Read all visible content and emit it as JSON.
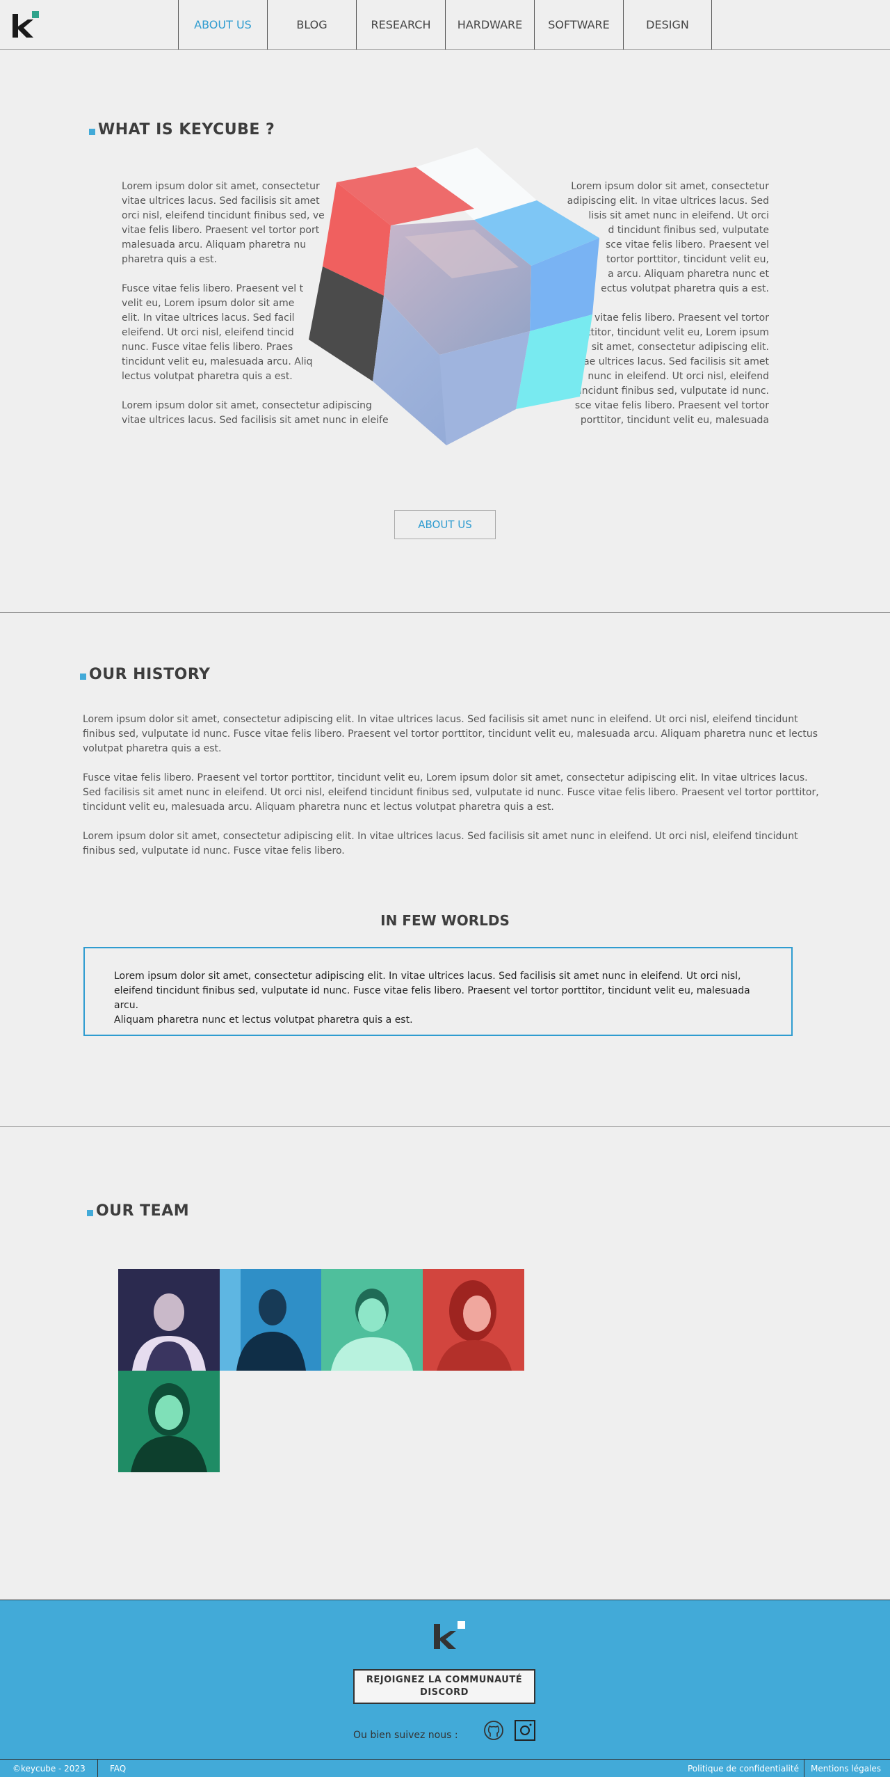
{
  "nav": {
    "items": [
      {
        "label": "ABOUT US",
        "active": true
      },
      {
        "label": "BLOG"
      },
      {
        "label": "RESEARCH"
      },
      {
        "label": "HARDWARE"
      },
      {
        "label": "SOFTWARE"
      },
      {
        "label": "DESIGN"
      }
    ]
  },
  "colors": {
    "accent": "#2f9cd0",
    "footer_bg": "#42aad8",
    "logo_green": "#2fa38b"
  },
  "what": {
    "title": "WHAT IS KEYCUBE ?",
    "left_lines_1": [
      "Lorem ipsum dolor sit amet, consectetur",
      "vitae ultrices lacus. Sed facilisis sit amet",
      "orci nisl, eleifend tincidunt finibus sed, ve",
      "vitae felis libero. Praesent vel tortor port",
      "malesuada arcu. Aliquam pharetra nu",
      "pharetra quis a est."
    ],
    "left_lines_2": [
      "Fusce vitae felis libero. Praesent vel t",
      "velit eu,  Lorem ipsum dolor sit ame",
      "elit. In vitae ultrices lacus. Sed facil",
      "eleifend. Ut orci nisl, eleifend tincid",
      "nunc. Fusce vitae felis libero. Praes",
      "tincidunt velit eu, malesuada arcu. Aliq",
      "lectus volutpat pharetra quis a est."
    ],
    "left_lines_3": [
      "Lorem ipsum dolor sit amet, consectetur adipiscing",
      "vitae ultrices lacus. Sed facilisis sit amet nunc in eleife"
    ],
    "right_lines_1": [
      "Lorem ipsum dolor sit amet, consectetur",
      "adipiscing elit. In vitae ultrices lacus. Sed",
      "lisis sit amet nunc in eleifend. Ut orci",
      "d tincidunt finibus sed, vulputate",
      "sce vitae felis libero. Praesent vel",
      "tortor porttitor, tincidunt velit eu,",
      "a arcu. Aliquam pharetra nunc et",
      "ectus volutpat pharetra quis a est."
    ],
    "right_lines_2": [
      "vitae felis libero. Praesent vel tortor",
      "ttitor, tincidunt velit eu,  Lorem ipsum",
      "sit amet, consectetur adipiscing elit.",
      "ae ultrices lacus. Sed facilisis sit amet",
      "nunc in eleifend. Ut orci nisl, eleifend",
      "tincidunt finibus sed, vulputate id nunc.",
      "sce vitae felis libero. Praesent vel tortor",
      "porttitor, tincidunt velit eu, malesuada"
    ],
    "button": "ABOUT US"
  },
  "history": {
    "title": "OUR HISTORY",
    "paragraphs": [
      [
        "Lorem ipsum dolor sit amet, consectetur adipiscing elit. In vitae ultrices lacus. Sed facilisis sit amet nunc in eleifend. Ut orci nisl, eleifend tincidunt",
        "finibus sed, vulputate id nunc. Fusce vitae felis libero. Praesent vel tortor porttitor, tincidunt velit eu, malesuada arcu. Aliquam pharetra nunc et lectus",
        "volutpat pharetra quis a est."
      ],
      [
        "Fusce vitae felis libero. Praesent vel tortor porttitor, tincidunt velit eu,  Lorem ipsum dolor sit amet, consectetur adipiscing elit. In vitae ultrices lacus.",
        "Sed facilisis sit amet nunc in eleifend. Ut orci nisl, eleifend tincidunt finibus sed, vulputate id nunc. Fusce vitae felis libero. Praesent vel tortor porttitor,",
        "tincidunt velit eu, malesuada arcu. Aliquam pharetra nunc et lectus volutpat pharetra quis a est."
      ],
      [
        "Lorem ipsum dolor sit amet, consectetur adipiscing elit. In vitae ultrices lacus. Sed facilisis sit amet nunc in eleifend. Ut orci nisl, eleifend tincidunt",
        "finibus sed, vulputate id nunc. Fusce vitae felis libero."
      ]
    ],
    "few_title": "IN FEW WORLDS",
    "quote_lines": [
      "Lorem ipsum dolor sit amet, consectetur adipiscing elit. In vitae ultrices lacus. Sed facilisis sit amet nunc in eleifend. Ut orci nisl,",
      "eleifend tincidunt finibus sed, vulputate id nunc. Fusce vitae felis libero. Praesent vel tortor porttitor, tincidunt velit eu, malesuada arcu.",
      "Aliquam pharetra nunc et lectus volutpat pharetra quis a est."
    ]
  },
  "team": {
    "title": "OUR TEAM",
    "members": [
      {
        "tint": "#2b2a4f"
      },
      {
        "tint": "#2f8fc7"
      },
      {
        "tint": "#5fd3b0"
      },
      {
        "tint": "#d2453e"
      },
      {
        "tint": "#1f8c65"
      }
    ]
  },
  "footer": {
    "discord_line1": "REJOIGNEZ LA COMMUNAUTÉ",
    "discord_line2": "DISCORD",
    "follow": "Ou bien suivez nous :",
    "copyright": "©keycube - 2023",
    "faq": "FAQ",
    "privacy": "Politique de confidentialité",
    "legal": "Mentions légales"
  }
}
